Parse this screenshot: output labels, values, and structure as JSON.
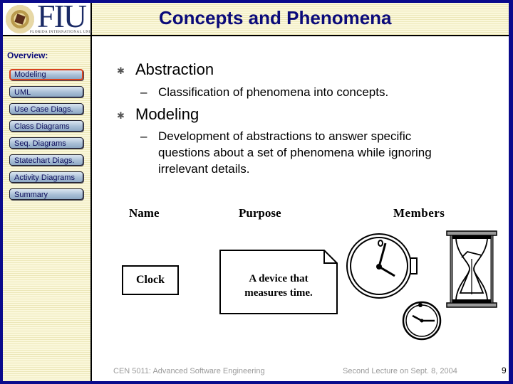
{
  "slide": {
    "title": "Concepts and Phenomena",
    "logo": {
      "text": "FIU",
      "subtitle": "FLORIDA INTERNATIONAL UNIVERSITY"
    }
  },
  "sidebar": {
    "heading": "Overview:",
    "items": [
      {
        "label": "Modeling",
        "active": true
      },
      {
        "label": "UML",
        "active": false
      },
      {
        "label": "Use Case Diags.",
        "active": false
      },
      {
        "label": "Class Diagrams",
        "active": false
      },
      {
        "label": "Seq. Diagrams",
        "active": false
      },
      {
        "label": "Statechart Diags.",
        "active": false
      },
      {
        "label": "Activity Diagrams",
        "active": false
      },
      {
        "label": "Summary",
        "active": false
      }
    ],
    "active_color": "#d9441f"
  },
  "content": {
    "bullets": [
      {
        "text": "Abstraction",
        "sub": [
          "Classification of phenomena into concepts."
        ]
      },
      {
        "text": "Modeling",
        "sub": [
          "Development of abstractions to answer specific",
          "questions about a set of phenomena while ignoring",
          "irrelevant details."
        ]
      }
    ],
    "bullet_icon": "asterisk-bullet-icon",
    "sub_bullet_glyph": "–"
  },
  "diagram": {
    "headers": {
      "name": "Name",
      "purpose": "Purpose",
      "members": "Members"
    },
    "name_box": "Clock",
    "purpose_note": [
      "A device that",
      "measures time."
    ],
    "members": [
      "wristwatch-icon",
      "hourglass-icon",
      "small-clock-icon"
    ]
  },
  "footer": {
    "course": "CEN 5011: Advanced Software Engineering",
    "lecture": "Second Lecture on Sept. 8, 2004",
    "page": "9"
  },
  "colors": {
    "frame": "#0a0a8c",
    "title": "#0b0b7a",
    "stripe_light": "#fbf8dc",
    "stripe_dark": "#ece7b8"
  }
}
